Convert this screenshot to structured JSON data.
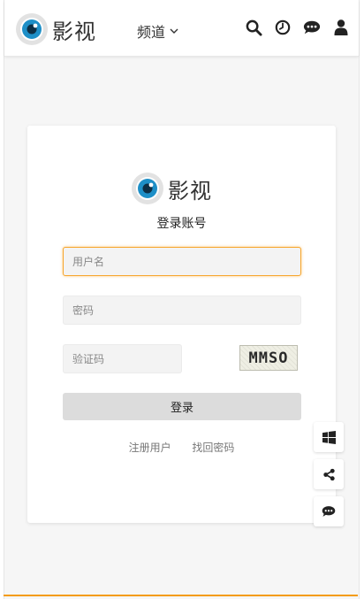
{
  "header": {
    "logo_text": "影视",
    "channel_label": "频道",
    "icons": [
      "search-icon",
      "history-icon",
      "chat-icon",
      "user-icon"
    ]
  },
  "login": {
    "logo_text": "影视",
    "title": "登录账号",
    "username_placeholder": "用户名",
    "password_placeholder": "密码",
    "captcha_placeholder": "验证码",
    "captcha_text": "MMSO",
    "submit_label": "登录",
    "register_label": "注册用户",
    "forgot_label": "找回密码"
  },
  "floating_bar": {
    "icons": [
      "windows-icon",
      "share-icon",
      "chat-icon"
    ]
  },
  "colors": {
    "accent": "#f39c12",
    "focus_border": "#f7a52b",
    "logo_blue": "#1e8fc7"
  }
}
